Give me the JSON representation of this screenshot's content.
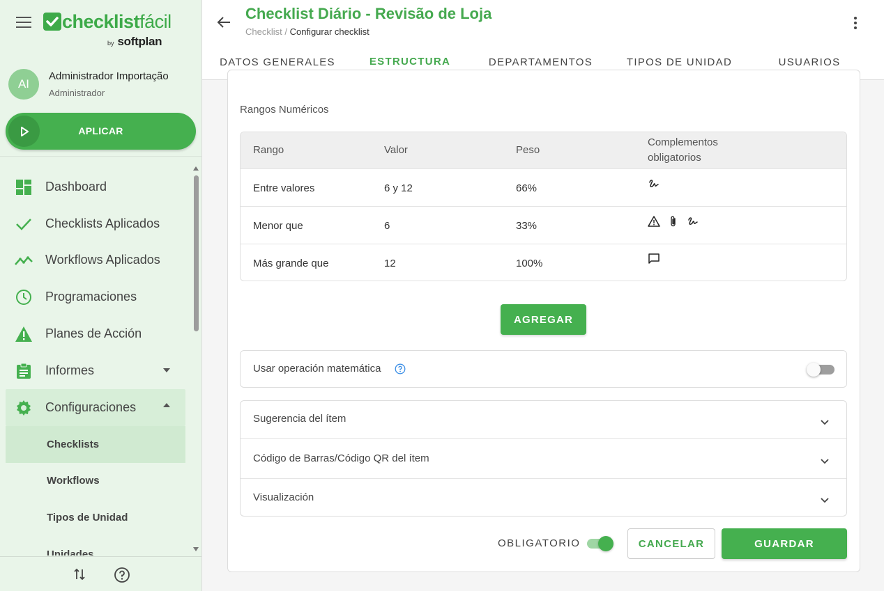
{
  "colors": {
    "accent": "#45b04f",
    "sidebar_bg": "#e9f5e9"
  },
  "brand": {
    "name_bold": "checklist",
    "name_thin": "fácil",
    "by": "by",
    "partner": "softplan"
  },
  "user": {
    "initials": "AI",
    "name": "Administrador Importação",
    "role": "Administrador"
  },
  "apply_label": "APLICAR",
  "nav": {
    "items": [
      {
        "label": "Dashboard",
        "icon": "dashboard-icon"
      },
      {
        "label": "Checklists Aplicados",
        "icon": "check-icon"
      },
      {
        "label": "Workflows Aplicados",
        "icon": "trending-icon"
      },
      {
        "label": "Programaciones",
        "icon": "clock-icon"
      },
      {
        "label": "Planes de Acción",
        "icon": "warning-icon"
      },
      {
        "label": "Informes",
        "icon": "clipboard-icon"
      },
      {
        "label": "Configuraciones",
        "icon": "gear-icon"
      }
    ],
    "sub_items": [
      "Checklists",
      "Workflows",
      "Tipos de Unidad",
      "Unidades"
    ]
  },
  "header": {
    "title": "Checklist Diário - Revisão de Loja",
    "breadcrumb_root": "Checklist",
    "breadcrumb_sep": " / ",
    "breadcrumb_current": "Configurar checklist"
  },
  "tabs": [
    "DATOS GENERALES",
    "ESTRUCTURA",
    "DEPARTAMENTOS",
    "TIPOS DE UNIDAD",
    "USUARIOS"
  ],
  "ranges": {
    "section_label": "Rangos Numéricos",
    "headers": [
      "Rango",
      "Valor",
      "Peso",
      "Complementos",
      "obligatorios"
    ],
    "rows": [
      {
        "rango": "Entre valores",
        "valor": "6 y 12",
        "peso": "66%",
        "icons": [
          "signature-icon"
        ]
      },
      {
        "rango": "Menor que",
        "valor": "6",
        "peso": "33%",
        "icons": [
          "warning-icon",
          "attachment-icon",
          "signature-icon"
        ]
      },
      {
        "rango": "Más grande que",
        "valor": "12",
        "peso": "100%",
        "icons": [
          "comment-icon"
        ]
      }
    ]
  },
  "add_label": "AGREGAR",
  "math_label": "Usar operación matemática",
  "math_enabled": false,
  "accordions": [
    "Sugerencia del ítem",
    "Código de Barras/Código QR del ítem",
    "Visualización"
  ],
  "footer": {
    "mandatory_label": "OBLIGATORIO",
    "mandatory_enabled": true,
    "cancel_label": "CANCELAR",
    "save_label": "GUARDAR"
  }
}
